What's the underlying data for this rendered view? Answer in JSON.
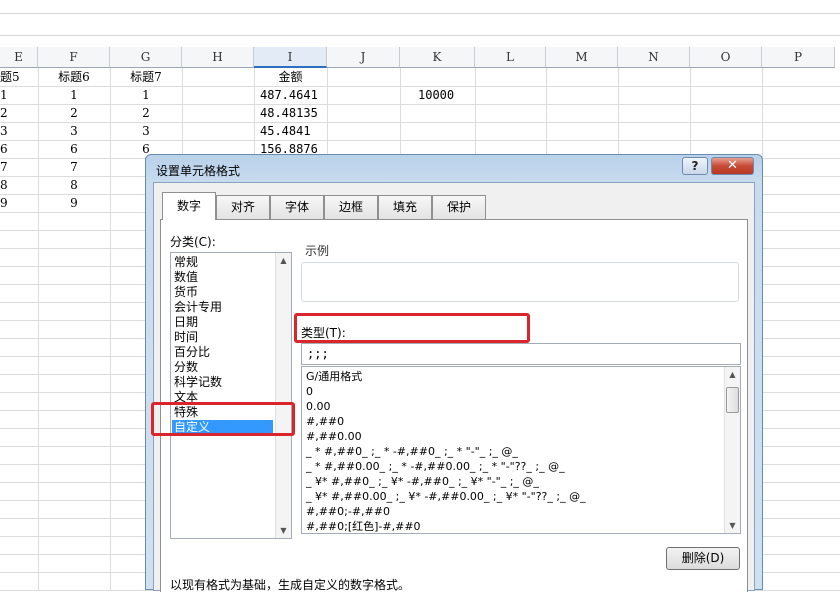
{
  "columns": [
    {
      "key": "E",
      "label": "E"
    },
    {
      "key": "F",
      "label": "F"
    },
    {
      "key": "G",
      "label": "G"
    },
    {
      "key": "H",
      "label": "H"
    },
    {
      "key": "I",
      "label": "I"
    },
    {
      "key": "J",
      "label": "J"
    },
    {
      "key": "K",
      "label": "K"
    },
    {
      "key": "L",
      "label": "L"
    },
    {
      "key": "M",
      "label": "M"
    },
    {
      "key": "N",
      "label": "N"
    },
    {
      "key": "O",
      "label": "O"
    },
    {
      "key": "P",
      "label": "P"
    }
  ],
  "rows": [
    {
      "E": "题5",
      "F": "标题6",
      "G": "标题7",
      "H": "",
      "I": "金额",
      "K": ""
    },
    {
      "E": "1",
      "F": "1",
      "G": "1",
      "H": "",
      "I": "487.4641",
      "K": "10000"
    },
    {
      "E": "2",
      "F": "2",
      "G": "2",
      "H": "",
      "I": "48.48135",
      "K": ""
    },
    {
      "E": "3",
      "F": "3",
      "G": "3",
      "H": "",
      "I": "45.4841",
      "K": ""
    },
    {
      "E": "6",
      "F": "6",
      "G": "6",
      "H": "",
      "I": "156.8876",
      "K": ""
    },
    {
      "E": "7",
      "F": "7",
      "G": "",
      "H": "",
      "I": "",
      "K": ""
    },
    {
      "E": "8",
      "F": "8",
      "G": "",
      "H": "",
      "I": "",
      "K": ""
    },
    {
      "E": "9",
      "F": "9",
      "G": "",
      "H": "",
      "I": "",
      "K": ""
    }
  ],
  "dialog": {
    "title": "设置单元格格式",
    "help_label": "?",
    "close_label": "✕",
    "tabs": [
      "数字",
      "对齐",
      "字体",
      "边框",
      "填充",
      "保护"
    ],
    "active_tab": "数字",
    "category_label": "分类(C):",
    "categories": [
      "常规",
      "数值",
      "货币",
      "会计专用",
      "日期",
      "时间",
      "百分比",
      "分数",
      "科学记数",
      "文本",
      "特殊",
      "自定义"
    ],
    "selected_category": "自定义",
    "example_label": "示例",
    "type_label": "类型(T):",
    "type_value": ";;;",
    "formats": [
      "G/通用格式",
      "0",
      "0.00",
      "#,##0",
      "#,##0.00",
      "_ * #,##0_ ;_ * -#,##0_ ;_ * \"-\"_ ;_ @_",
      "_ * #,##0.00_ ;_ * -#,##0.00_ ;_ * \"-\"??_ ;_ @_",
      "_ ¥* #,##0_ ;_ ¥* -#,##0_ ;_ ¥* \"-\"_ ;_ @_",
      "_ ¥* #,##0.00_ ;_ ¥* -#,##0.00_ ;_ ¥* \"-\"??_ ;_ @_",
      "#,##0;-#,##0",
      "#,##0;[红色]-#,##0"
    ],
    "delete_label": "删除(D)",
    "description": "以现有格式为基础，生成自定义的数字格式。"
  },
  "colors": {
    "highlight": "#d9252b",
    "selection": "#3399ff"
  }
}
